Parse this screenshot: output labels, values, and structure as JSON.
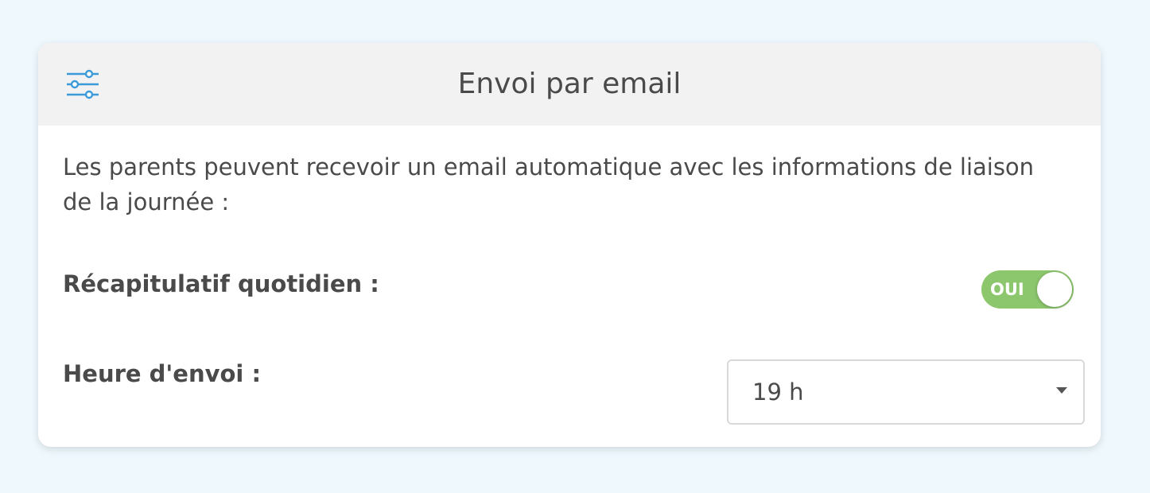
{
  "card": {
    "title": "Envoi par email",
    "settings_icon": "sliders-icon",
    "description": "Les parents peuvent recevoir un email automatique avec les informations de liaison de la journée :"
  },
  "daily_summary": {
    "label": "Récapitulatif quotidien :",
    "toggle_label": "OUI",
    "enabled": true
  },
  "send_time": {
    "label": "Heure d'envoi :",
    "selected": "19 h"
  },
  "colors": {
    "background": "#eef8fd",
    "header_background": "#f2f2f2",
    "accent_icon": "#3d9ad9",
    "toggle_on": "#8cc66d",
    "text": "#4a4a4a"
  }
}
